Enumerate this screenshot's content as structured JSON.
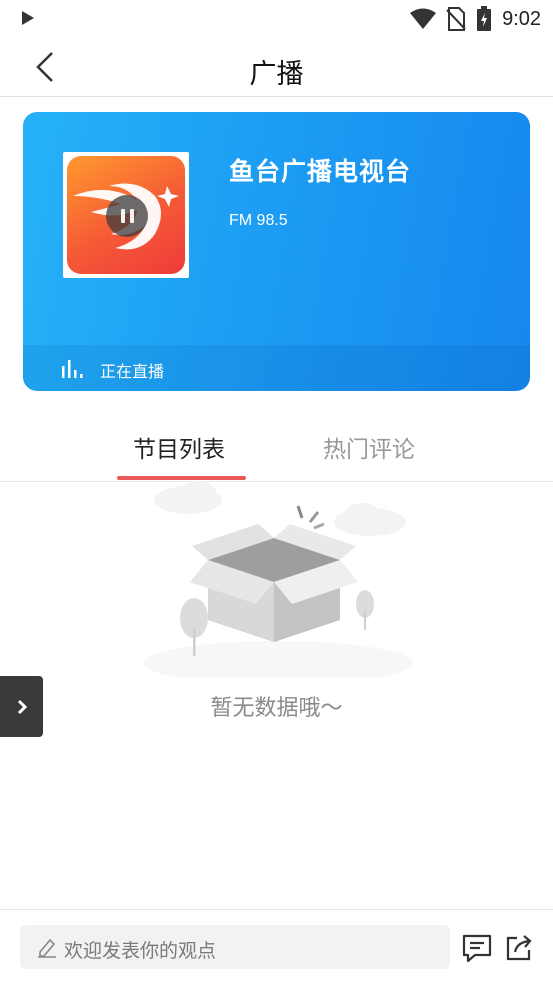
{
  "status_bar": {
    "time": "9:02",
    "icons": [
      "play-indicator-icon",
      "wifi-icon",
      "no-sim-icon",
      "battery-charging-icon"
    ]
  },
  "header": {
    "title": "广播",
    "back_icon": "back-arrow-icon"
  },
  "radio": {
    "station_name": "鱼台广播电视台",
    "frequency": "FM 98.5",
    "live_label": "正在直播",
    "cover_icon": "station-logo",
    "play_state": "pause-icon",
    "colors": {
      "card_start": "#25b2f7",
      "card_end": "#1688ee",
      "logo_start": "#ff9a2e",
      "logo_end": "#ee3b3a"
    }
  },
  "tabs": [
    {
      "label": "节目列表",
      "active": true
    },
    {
      "label": "热门评论",
      "active": false
    }
  ],
  "empty_state": {
    "message": "暂无数据哦～",
    "icon": "empty-box-illustration"
  },
  "side_handle": {
    "icon": "chevron-right-icon"
  },
  "bottom_bar": {
    "comment_placeholder": "欢迎发表你的观点",
    "icons": [
      "pen-icon",
      "comment-icon",
      "share-icon"
    ]
  },
  "accent_color": "#e85a5a"
}
